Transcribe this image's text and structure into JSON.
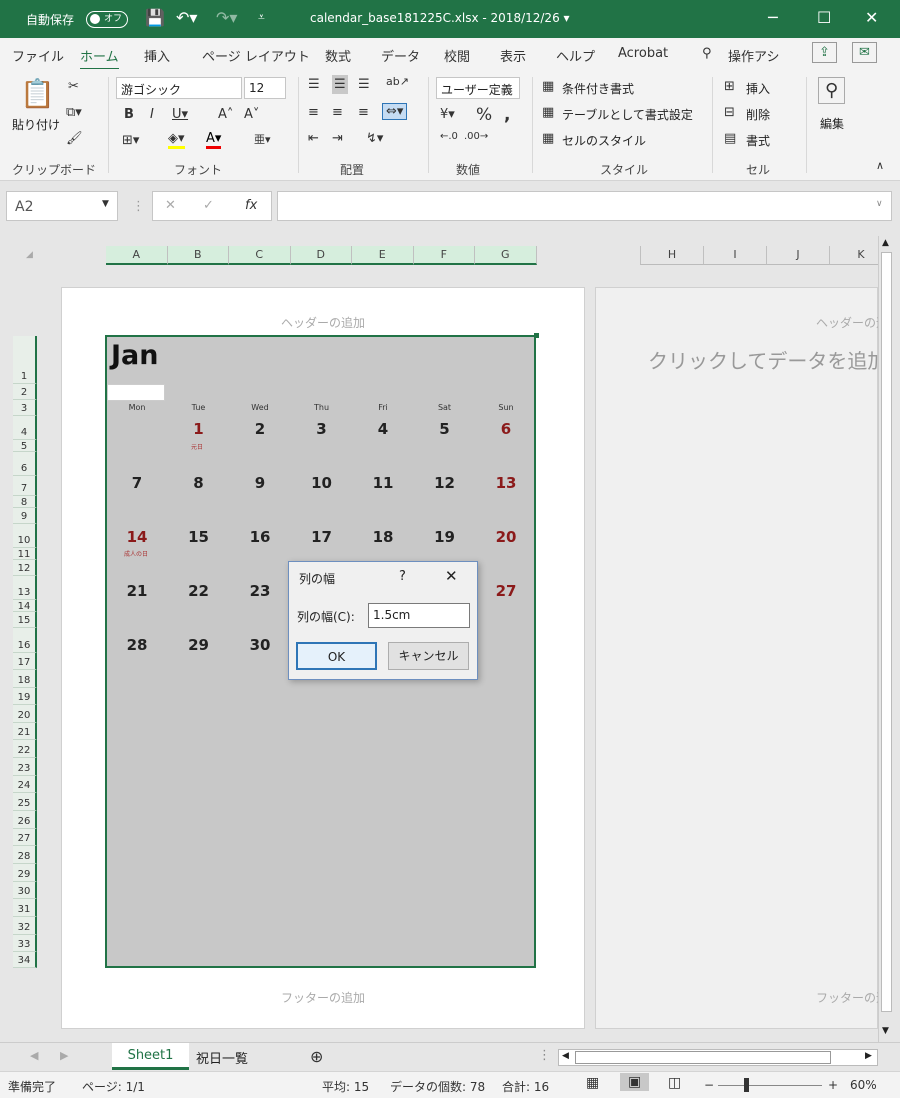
{
  "title_bar": {
    "autosave_label": "自動保存",
    "autosave_state": "オフ",
    "file_title": "calendar_base181225C.xlsx - 2018/12/26 ▾"
  },
  "tabs": [
    "ファイル",
    "ホーム",
    "挿入",
    "ページ レイアウト",
    "数式",
    "データ",
    "校閲",
    "表示",
    "ヘルプ",
    "Acrobat",
    "操作アシ"
  ],
  "ribbon": {
    "paste": "貼り付け",
    "font_name": "游ゴシック",
    "font_size": "12",
    "number_format": "ユーザー定義",
    "cond_format": "条件付き書式",
    "table_format": "テーブルとして書式設定",
    "cell_style": "セルのスタイル",
    "insert": "挿入",
    "delete": "削除",
    "format": "書式",
    "edit": "編集",
    "groups": {
      "clipboard": "クリップボード",
      "font": "フォント",
      "align": "配置",
      "number": "数値",
      "style": "スタイル",
      "cells": "セル"
    }
  },
  "formula_bar": {
    "name_box": "A2",
    "fx": "fx"
  },
  "columns_left": [
    "A",
    "B",
    "C",
    "D",
    "E",
    "F",
    "G"
  ],
  "columns_right": [
    "H",
    "I",
    "J",
    "K"
  ],
  "page": {
    "header_add": "ヘッダーの追加",
    "footer_add": "フッターの追加",
    "header_add_right": "ヘッダーの追",
    "footer_add_right": "フッターの追",
    "click_to_add": "クリックしてデータを追加"
  },
  "rows": [
    "1",
    "2",
    "3",
    "4",
    "5",
    "6",
    "7",
    "8",
    "9",
    "10",
    "11",
    "12",
    "13",
    "14",
    "15",
    "16",
    "17",
    "18",
    "19",
    "20",
    "21",
    "22",
    "23",
    "24",
    "25",
    "26",
    "27",
    "28",
    "29",
    "30",
    "31",
    "32",
    "33",
    "34"
  ],
  "calendar": {
    "month": "Jan",
    "dows": [
      "Mon",
      "Tue",
      "Wed",
      "Thu",
      "Fri",
      "Sat",
      "Sun"
    ],
    "weeks": [
      [
        "",
        "1",
        "2",
        "3",
        "4",
        "5",
        "6"
      ],
      [
        "7",
        "8",
        "9",
        "10",
        "11",
        "12",
        "13"
      ],
      [
        "14",
        "15",
        "16",
        "17",
        "18",
        "19",
        "20"
      ],
      [
        "21",
        "22",
        "23",
        "",
        "",
        "",
        "27"
      ],
      [
        "28",
        "29",
        "30",
        "",
        "",
        "",
        ""
      ]
    ],
    "holiday_1": "元日",
    "holiday_14": "成人の日"
  },
  "dialog": {
    "title": "列の幅",
    "help": "?",
    "close": "✕",
    "label": "列の幅(C):",
    "value": "1.5cm",
    "ok": "OK",
    "cancel": "キャンセル"
  },
  "sheets": {
    "active": "Sheet1",
    "other": "祝日一覧"
  },
  "status": {
    "ready": "準備完了",
    "page": "ページ: 1/1",
    "avg": "平均: 15",
    "count": "データの個数: 78",
    "sum": "合計: 16",
    "zoom": "60%"
  }
}
